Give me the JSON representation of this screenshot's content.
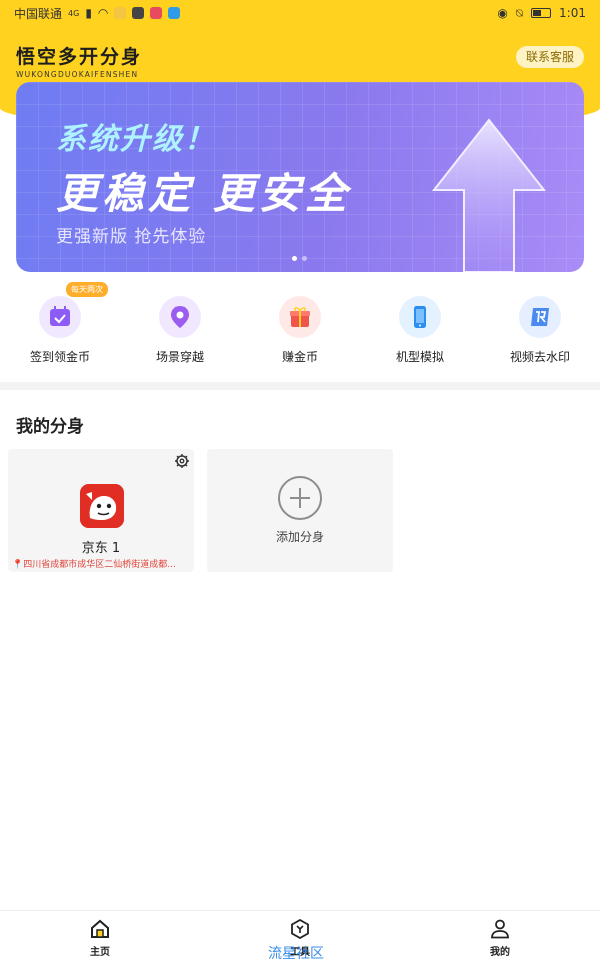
{
  "status_bar": {
    "carrier": "中国联通",
    "signal": "4G",
    "time": "1:01"
  },
  "header": {
    "title": "悟空多开分身",
    "subtitle": "WUKONGDUOKAIFENSHEN",
    "contact_label": "联系客服"
  },
  "banner": {
    "line1": "系统升级！",
    "line2": "更稳定 更安全",
    "line3": "更强新版 抢先体验",
    "slide_index": 1,
    "slide_count": 2
  },
  "quick_actions": {
    "badge": "每天两次",
    "items": [
      {
        "label": "签到领金币",
        "icon": "calendar-check-icon",
        "color": "#8c5cf5"
      },
      {
        "label": "场景穿越",
        "icon": "location-pin-icon",
        "color": "#9b5cf0"
      },
      {
        "label": "赚金币",
        "icon": "gift-icon",
        "color": "#f0554b"
      },
      {
        "label": "机型模拟",
        "icon": "phone-icon",
        "color": "#2b8ef0"
      },
      {
        "label": "视频去水印",
        "icon": "watermark-icon",
        "color": "#4b8af0"
      }
    ]
  },
  "clones": {
    "title": "我的分身",
    "items": [
      {
        "name": "京东  1",
        "location": "四川省成都市成华区二仙桥街道成都...",
        "icon": "jd-app-icon"
      }
    ],
    "add_label": "添加分身"
  },
  "nav": {
    "items": [
      {
        "label": "主页",
        "icon": "home-icon"
      },
      {
        "label": "工具",
        "icon": "tools-icon"
      },
      {
        "label": "我的",
        "icon": "profile-icon"
      }
    ]
  },
  "watermark": "流星社区",
  "colors": {
    "brand_yellow": "#ffd21f",
    "accent_red": "#e0443a",
    "banner_purple": "#8a79ee"
  }
}
